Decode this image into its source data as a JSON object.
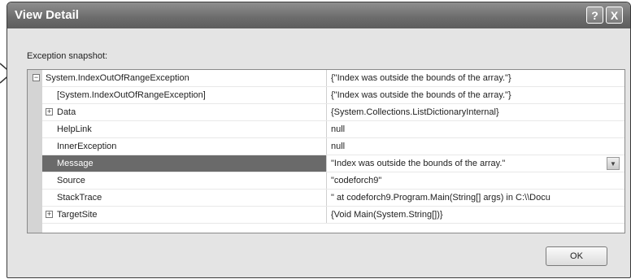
{
  "dialog": {
    "title": "View Detail",
    "help_label": "?",
    "close_label": "X",
    "snapshot_label": "Exception snapshot:",
    "ok_label": "OK"
  },
  "rows": [
    {
      "name": "System.IndexOutOfRangeException",
      "value": "{\"Index was outside the bounds of the array.\"}",
      "expander": "minus",
      "level": 0
    },
    {
      "name": "[System.IndexOutOfRangeException]",
      "value": "{\"Index was outside the bounds of the array.\"}",
      "expander": "",
      "level": 1
    },
    {
      "name": "Data",
      "value": "{System.Collections.ListDictionaryInternal}",
      "expander": "plus",
      "level": 1
    },
    {
      "name": "HelpLink",
      "value": "null",
      "expander": "",
      "level": 1
    },
    {
      "name": "InnerException",
      "value": "null",
      "expander": "",
      "level": 1
    },
    {
      "name": "Message",
      "value": "\"Index was outside the bounds of the array.\"",
      "expander": "",
      "level": 1,
      "selected": true
    },
    {
      "name": "Source",
      "value": "\"codeforch9\"",
      "expander": "",
      "level": 1
    },
    {
      "name": "StackTrace",
      "value": "\"   at codeforch9.Program.Main(String[] args) in C:\\\\Docu",
      "expander": "",
      "level": 1
    },
    {
      "name": "TargetSite",
      "value": "{Void Main(System.String[])}",
      "expander": "plus",
      "level": 1
    }
  ],
  "icons": {
    "expander_minus": "minus-box-icon",
    "expander_plus": "plus-box-icon",
    "dropdown": "chevron-down-icon",
    "pointer": "arrow-pointer-icon"
  }
}
